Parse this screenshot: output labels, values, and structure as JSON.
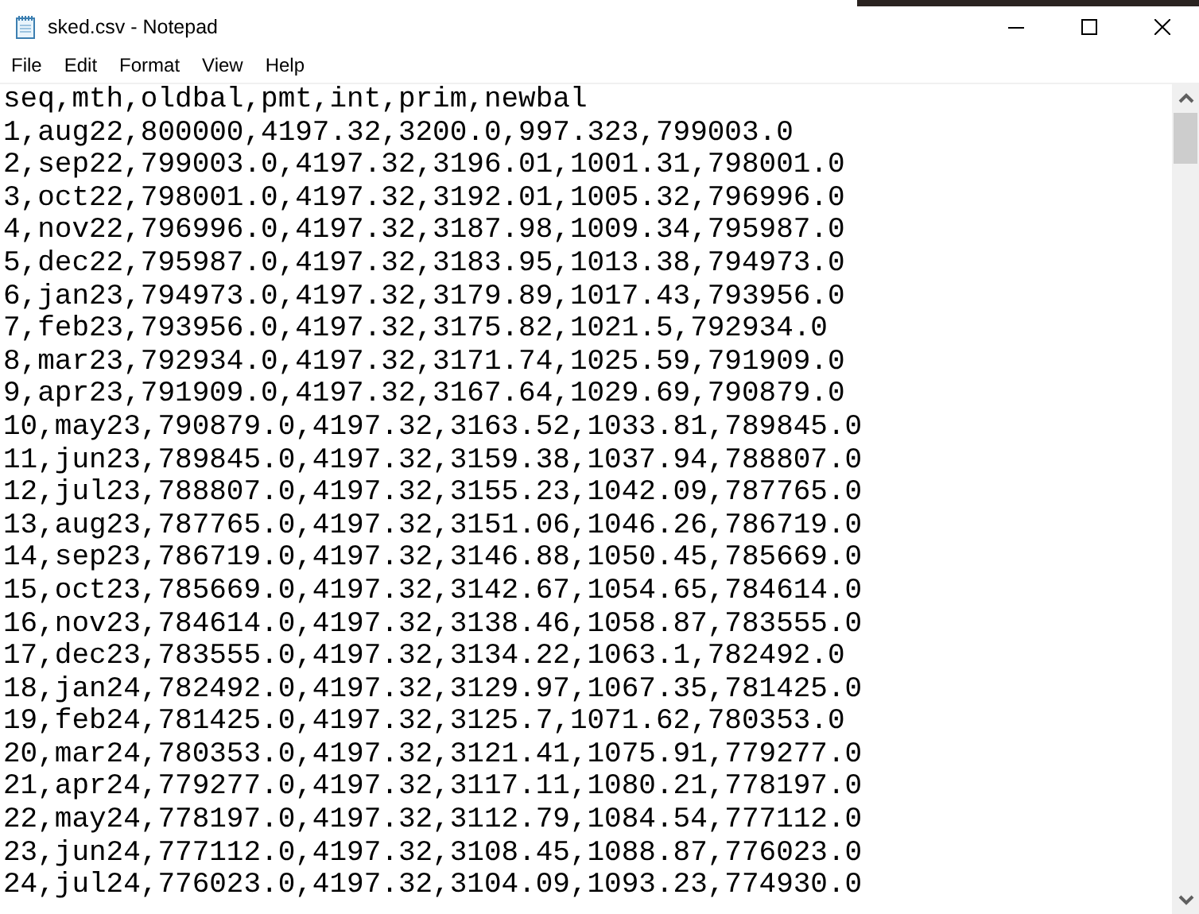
{
  "window": {
    "title": "sked.csv - Notepad"
  },
  "menu": [
    "File",
    "Edit",
    "Format",
    "View",
    "Help"
  ],
  "lines": [
    "seq,mth,oldbal,pmt,int,prim,newbal",
    "1,aug22,800000,4197.32,3200.0,997.323,799003.0",
    "2,sep22,799003.0,4197.32,3196.01,1001.31,798001.0",
    "3,oct22,798001.0,4197.32,3192.01,1005.32,796996.0",
    "4,nov22,796996.0,4197.32,3187.98,1009.34,795987.0",
    "5,dec22,795987.0,4197.32,3183.95,1013.38,794973.0",
    "6,jan23,794973.0,4197.32,3179.89,1017.43,793956.0",
    "7,feb23,793956.0,4197.32,3175.82,1021.5,792934.0",
    "8,mar23,792934.0,4197.32,3171.74,1025.59,791909.0",
    "9,apr23,791909.0,4197.32,3167.64,1029.69,790879.0",
    "10,may23,790879.0,4197.32,3163.52,1033.81,789845.0",
    "11,jun23,789845.0,4197.32,3159.38,1037.94,788807.0",
    "12,jul23,788807.0,4197.32,3155.23,1042.09,787765.0",
    "13,aug23,787765.0,4197.32,3151.06,1046.26,786719.0",
    "14,sep23,786719.0,4197.32,3146.88,1050.45,785669.0",
    "15,oct23,785669.0,4197.32,3142.67,1054.65,784614.0",
    "16,nov23,784614.0,4197.32,3138.46,1058.87,783555.0",
    "17,dec23,783555.0,4197.32,3134.22,1063.1,782492.0",
    "18,jan24,782492.0,4197.32,3129.97,1067.35,781425.0",
    "19,feb24,781425.0,4197.32,3125.7,1071.62,780353.0",
    "20,mar24,780353.0,4197.32,3121.41,1075.91,779277.0",
    "21,apr24,779277.0,4197.32,3117.11,1080.21,778197.0",
    "22,may24,778197.0,4197.32,3112.79,1084.54,777112.0",
    "23,jun24,777112.0,4197.32,3108.45,1088.87,776023.0",
    "24,jul24,776023.0,4197.32,3104.09,1093.23,774930.0"
  ]
}
